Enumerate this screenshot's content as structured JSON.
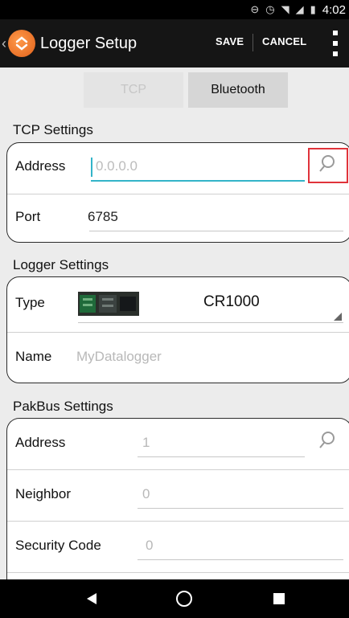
{
  "status_bar": {
    "time": "4:02",
    "icons": [
      "sync-icon",
      "alarm-icon",
      "wifi-icon",
      "signal-icon",
      "battery-icon"
    ]
  },
  "app_bar": {
    "title": "Logger Setup",
    "save_label": "SAVE",
    "cancel_label": "CANCEL"
  },
  "connection_tabs": {
    "tcp": "TCP",
    "bluetooth": "Bluetooth",
    "selected": "Bluetooth"
  },
  "tcp_settings": {
    "title": "TCP Settings",
    "address_label": "Address",
    "address_placeholder": "0.0.0.0",
    "port_label": "Port",
    "port_value": "6785"
  },
  "logger_settings": {
    "title": "Logger Settings",
    "type_label": "Type",
    "type_value": "CR1000",
    "name_label": "Name",
    "name_placeholder": "MyDatalogger"
  },
  "pakbus_settings": {
    "title": "PakBus Settings",
    "address_label": "Address",
    "address_placeholder": "1",
    "neighbor_label": "Neighbor",
    "neighbor_placeholder": "0",
    "security_label": "Security Code",
    "security_placeholder": "0"
  },
  "colors": {
    "accent": "#33b4c9",
    "highlight_box": "#e0333a",
    "app_bar": "#151515"
  }
}
